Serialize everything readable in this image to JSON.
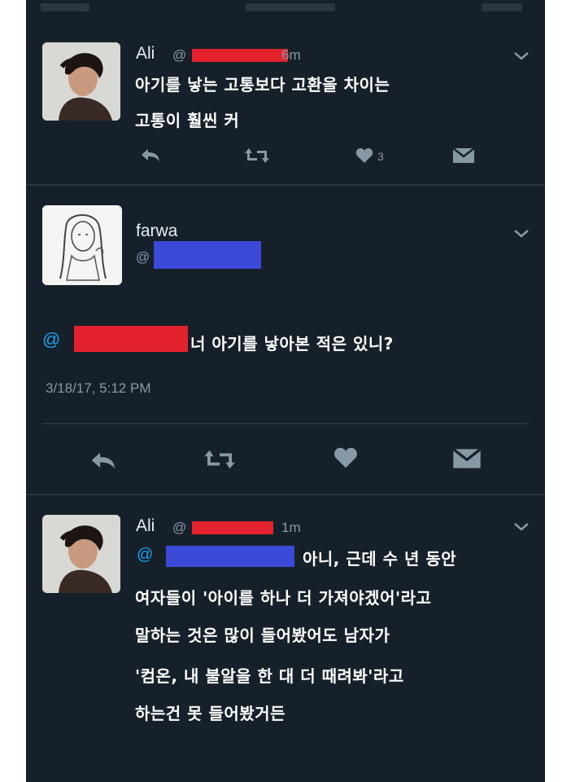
{
  "tweets": [
    {
      "name": "Ali",
      "handle_prefix": "@",
      "time": "6m",
      "text_lines": [
        "아기를 낳는 고통보다 고환을 차이는",
        "고통이 훨씬 커"
      ],
      "like_count": "3"
    },
    {
      "name": "farwa",
      "handle_prefix": "@",
      "mention_prefix": "@",
      "text": "너 아기를 낳아본 적은 있니?",
      "date": "3/18/17, 5:12 PM"
    },
    {
      "name": "Ali",
      "handle_prefix": "@",
      "time": "1m",
      "mention_prefix": "@",
      "text_lines": [
        "아니, 근데 수 년 동안",
        "여자들이 '아이를 하나 더 가져야겠어'라고",
        "말하는 것은 많이 들어봤어도 남자가",
        "'컴온, 내 불알을 한 대 더 때려봐'라고",
        "하는건 못 들어봤거든"
      ]
    }
  ],
  "icons": {
    "reply": "reply-icon",
    "retweet": "retweet-icon",
    "like": "heart-icon",
    "dm": "envelope-icon",
    "more": "chevron-down-icon"
  },
  "colors": {
    "background": "#16202b",
    "text": "#ffffff",
    "muted": "#8899a6",
    "redaction_red": "#e4222e",
    "redaction_blue": "#3a4ad6",
    "link": "#1da1f2"
  }
}
